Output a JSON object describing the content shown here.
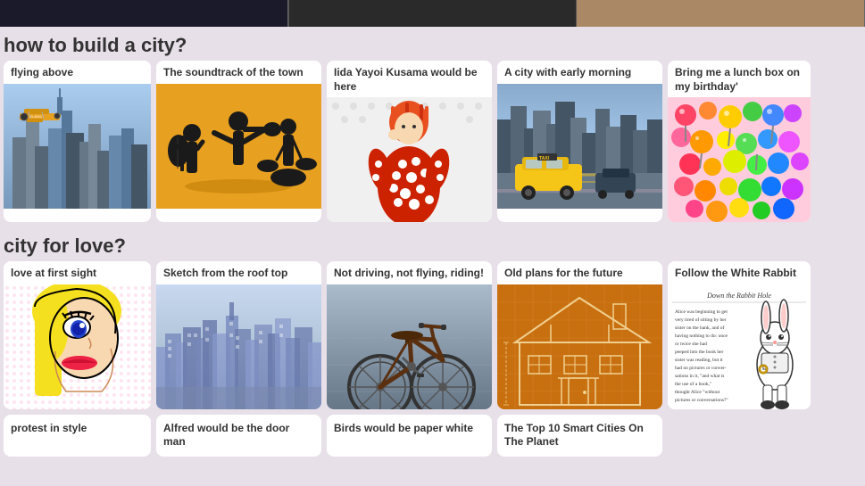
{
  "page": {
    "bg_color": "#e8e0e8"
  },
  "top_strip": {
    "images": [
      {
        "id": "strip-1",
        "bg": "#2a2a2a"
      },
      {
        "id": "strip-2",
        "bg": "#3a3a3a"
      },
      {
        "id": "strip-3",
        "bg": "#888"
      }
    ]
  },
  "sections": [
    {
      "id": "section-city",
      "header": "how to build a city?",
      "cards": [
        {
          "id": "card-flying-above",
          "title": "flying above",
          "image_type": "biplane"
        },
        {
          "id": "card-soundtrack",
          "title": "The soundtrack of the town",
          "image_type": "jazz"
        },
        {
          "id": "card-kusama",
          "title": "Iida Yayoi Kusama would be here",
          "image_type": "kusama"
        },
        {
          "id": "card-morning",
          "title": "A city with early morning",
          "image_type": "nyc"
        },
        {
          "id": "card-lunch",
          "title": "Bring me a lunch box on my birthday'",
          "image_type": "candy"
        }
      ]
    },
    {
      "id": "section-love",
      "header": "city for love?",
      "cards": [
        {
          "id": "card-love-sight",
          "title": "love at first sight",
          "image_type": "comic"
        },
        {
          "id": "card-rooftop",
          "title": "Sketch from the roof top",
          "image_type": "skyline"
        },
        {
          "id": "card-bike",
          "title": "Not driving, not flying, riding!",
          "image_type": "bike"
        },
        {
          "id": "card-plans",
          "title": "Old plans for the future",
          "image_type": "blueprint"
        },
        {
          "id": "card-rabbit",
          "title": "Follow the White Rabbit",
          "image_type": "alice"
        }
      ]
    }
  ],
  "bottom_row": [
    {
      "id": "bottom-style",
      "title": "protest in style",
      "image_type": "dark"
    },
    {
      "id": "bottom-alfred",
      "title": "Alfred would be the door man",
      "image_type": "medium"
    },
    {
      "id": "bottom-birds",
      "title": "Birds would be paper white",
      "image_type": "light"
    },
    {
      "id": "bottom-smart",
      "title": "The Top 10 Smart Cities On The Planet",
      "image_type": "city"
    }
  ],
  "labels": {
    "section1_header": "how to build a city?",
    "section2_header": "city for love?",
    "card1_title": "flying above",
    "card2_title": "The soundtrack of the town",
    "card3_title": "Iida Yayoi Kusama would be here",
    "card4_title": "A city with early morning",
    "card5_title": "Bring me a lunch box on my birthday'",
    "card6_title": "love at first sight",
    "card7_title": "Sketch from the roof top",
    "card8_title": "Not driving, not flying, riding!",
    "card9_title": "Old plans for the future",
    "card10_title": "Follow the White Rabbit",
    "bottom1_title": "protest in style",
    "bottom2_title": "Alfred would be the door man",
    "bottom3_title": "Birds would be paper white",
    "bottom4_title": "The Top 10 Smart Cities On The Planet"
  }
}
